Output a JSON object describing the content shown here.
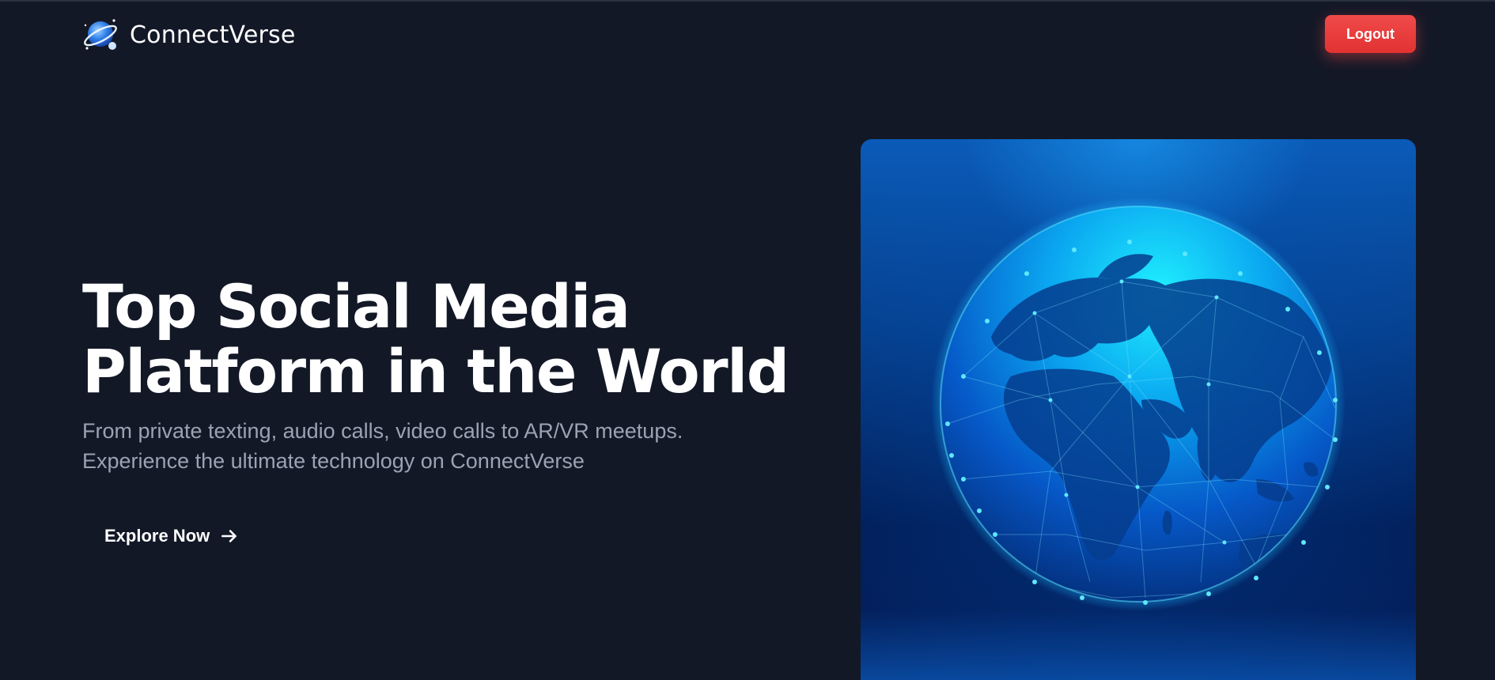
{
  "header": {
    "brand_name": "ConnectVerse",
    "logout_label": "Logout"
  },
  "hero": {
    "title_line1": "Top Social Media",
    "title_line2": "Platform in the World",
    "subtitle": "From private texting, audio calls, video calls to AR/VR meetups. Experience the ultimate technology on ConnectVerse",
    "cta_label": "Explore Now"
  },
  "colors": {
    "background": "#131827",
    "logout_button": "#ef4444",
    "subtitle_text": "#9aa3b2",
    "globe_accent": "#1ec8ff"
  },
  "icons": {
    "logo": "planet-logo-icon",
    "cta_arrow": "arrow-right-icon"
  }
}
